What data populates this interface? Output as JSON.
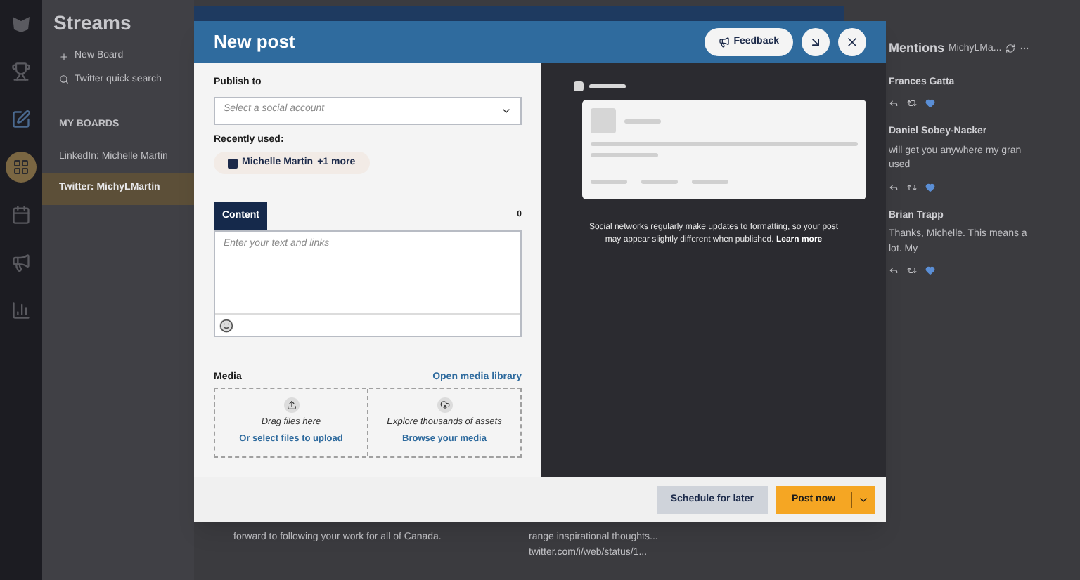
{
  "rail": [
    {
      "kind": "logo",
      "selected": false
    },
    {
      "kind": "trophy",
      "selected": false
    },
    {
      "kind": "compose",
      "selected": false
    },
    {
      "kind": "streams",
      "selected": true
    },
    {
      "kind": "calendar",
      "selected": false
    },
    {
      "kind": "megaphone",
      "selected": false
    },
    {
      "kind": "analytics",
      "selected": false
    }
  ],
  "sidebar": {
    "title": "Streams",
    "actions": [
      {
        "kind": "add",
        "label": "New Board"
      },
      {
        "kind": "search",
        "label": "Twitter quick search"
      }
    ],
    "section": "MY BOARDS",
    "boards": [
      {
        "label": "LinkedIn: Michelle Martin",
        "selected": false
      },
      {
        "label": "Twitter: MichyLMartin",
        "selected": true
      }
    ]
  },
  "stream": {
    "title": "Mentions",
    "account": "MichyLMa...",
    "posts": [
      {
        "author": "Frances Gatta"
      },
      {
        "author": "Daniel Sobey-Nacker",
        "text": "will get you anywhere my gran used"
      },
      {
        "author": "Brian Trapp",
        "text": "Thanks, Michelle. This means a lot. My"
      }
    ]
  },
  "bottom_snippets": [
    "forward to following your work for all of Canada.",
    "range inspirational thoughts... twitter.com/i/web/status/1..."
  ],
  "modal": {
    "title": "New post",
    "feedback": "Feedback",
    "publish_label": "Publish to",
    "account_select": {
      "placeholder": "Select a social account"
    },
    "recent_label": "Recently used:",
    "recent_chip": "Michelle Martin",
    "recent_more": "+1 more",
    "content_tab": "Content",
    "char_count": "0",
    "content_field": {
      "placeholder": "Enter your text and links"
    },
    "media_label": "Media",
    "media_link": "Open media library",
    "media_options": [
      {
        "kind": "upload",
        "hint": "Drag files here",
        "action": "Or select files to upload"
      },
      {
        "kind": "library",
        "hint": "Explore thousands of assets",
        "action": "Browse your media"
      }
    ],
    "preview_note": "Social networks regularly make updates to formatting, so your post may appear slightly different when published.",
    "learn_more": "Learn more",
    "schedule": "Schedule for later",
    "post": "Post now"
  }
}
